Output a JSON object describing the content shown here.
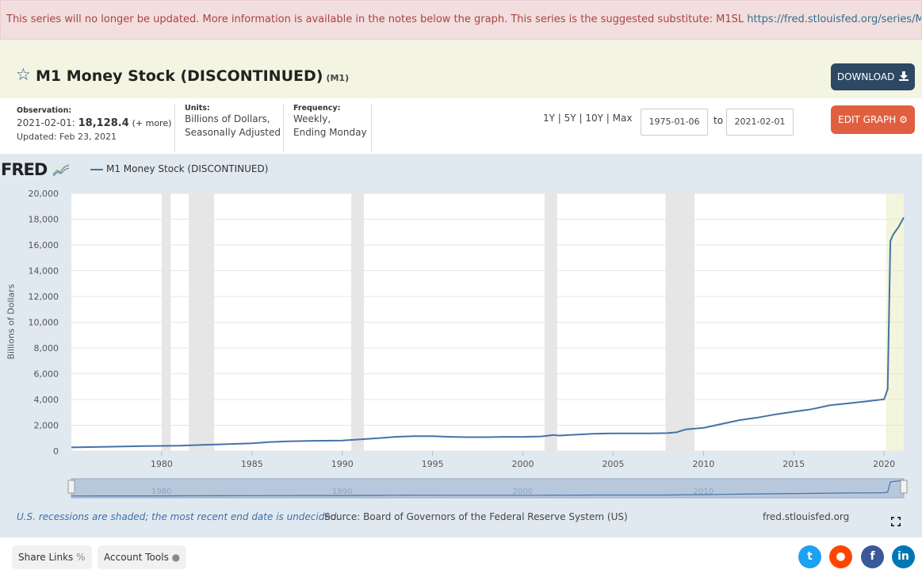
{
  "alert": {
    "message": "This series will no longer be updated. More information is available in the notes below the graph. This series is the suggested substitute: M1SL",
    "link": "https://fred.stlouisfed.org/series/M1SL"
  },
  "header": {
    "title": "M1 Money Stock (DISCONTINUED)",
    "series_code": "(M1)",
    "download_label": "DOWNLOAD",
    "star_icon": "star-outline-icon"
  },
  "info": {
    "observation_label": "Observation:",
    "observation_date": "2021-02-01:",
    "observation_value": "18,128.4",
    "observation_more": "(+ more)",
    "updated": "Updated: Feb 23, 2021",
    "units_label": "Units:",
    "units_line1": "Billions of Dollars,",
    "units_line2": "Seasonally Adjusted",
    "frequency_label": "Frequency:",
    "frequency_line1": "Weekly,",
    "frequency_line2": "Ending Monday"
  },
  "controls": {
    "ranges": [
      "1Y",
      "5Y",
      "10Y",
      "Max"
    ],
    "separator": "|",
    "start_date": "1975-01-06",
    "to_label": "to",
    "end_date": "2021-02-01",
    "edit_label": "EDIT GRAPH"
  },
  "brand": {
    "logo": "FRED"
  },
  "chart_data": {
    "type": "line",
    "title": "",
    "legend": "M1 Money Stock (DISCONTINUED)",
    "xlabel": "",
    "ylabel": "Billions of Dollars",
    "xlim": [
      1975.0,
      2021.09
    ],
    "ylim": [
      0,
      20000
    ],
    "yticks": [
      0,
      2000,
      4000,
      6000,
      8000,
      10000,
      12000,
      14000,
      16000,
      18000,
      20000
    ],
    "ytick_labels": [
      "0",
      "2,000",
      "4,000",
      "6,000",
      "8,000",
      "10,000",
      "12,000",
      "14,000",
      "16,000",
      "18,000",
      "20,000"
    ],
    "xticks": [
      1980,
      1985,
      1990,
      1995,
      2000,
      2005,
      2010,
      2015,
      2020
    ],
    "xtick_labels": [
      "1980",
      "1985",
      "1990",
      "1995",
      "2000",
      "2005",
      "2010",
      "2015",
      "2020"
    ],
    "navigator_ticks": [
      "1980",
      "1990",
      "2000",
      "2010"
    ],
    "navigator_tick_values": [
      1980,
      1990,
      2000,
      2010
    ],
    "recessions": [
      [
        1980.0,
        1980.5
      ],
      [
        1981.5,
        1982.9
      ],
      [
        1990.5,
        1991.2
      ],
      [
        2001.2,
        2001.9
      ],
      [
        2007.9,
        2009.5
      ],
      [
        2020.1,
        2021.09
      ]
    ],
    "series": [
      {
        "name": "M1 Money Stock (DISCONTINUED)",
        "color": "#4572a7",
        "x": [
          1975.0,
          1977,
          1979,
          1981,
          1983,
          1985,
          1986,
          1987,
          1988,
          1990,
          1992,
          1993,
          1994,
          1995,
          1996,
          1997,
          1998,
          1999,
          2000,
          2001,
          2001.7,
          2002,
          2003,
          2004,
          2005,
          2006,
          2007,
          2008,
          2008.5,
          2009,
          2010,
          2011,
          2012,
          2013,
          2014,
          2015,
          2016,
          2017,
          2018,
          2019,
          2020.0,
          2020.2,
          2020.35,
          2020.5,
          2020.8,
          2021.09
        ],
        "y": [
          285,
          330,
          380,
          420,
          510,
          600,
          700,
          750,
          780,
          820,
          1000,
          1110,
          1150,
          1150,
          1100,
          1080,
          1080,
          1100,
          1100,
          1130,
          1250,
          1200,
          1280,
          1350,
          1370,
          1370,
          1370,
          1390,
          1450,
          1680,
          1800,
          2100,
          2400,
          2600,
          2850,
          3050,
          3250,
          3550,
          3700,
          3850,
          4020,
          4800,
          16300,
          16800,
          17400,
          18128.4
        ]
      }
    ]
  },
  "footer": {
    "recession_note": "U.S. recessions are shaded; the most recent end date is undecided.",
    "source": "Source: Board of Governors of the Federal Reserve System (US)",
    "site": "fred.stlouisfed.org"
  },
  "bottom": {
    "share_label": "Share Links",
    "account_label": "Account Tools"
  },
  "colors": {
    "line": "#4572a7",
    "navy": "#2d4863",
    "orange": "#e15f3f",
    "twitter": "#1da1f2",
    "reddit": "#ff4500",
    "facebook": "#3b5998",
    "linkedin": "#0077b5"
  }
}
